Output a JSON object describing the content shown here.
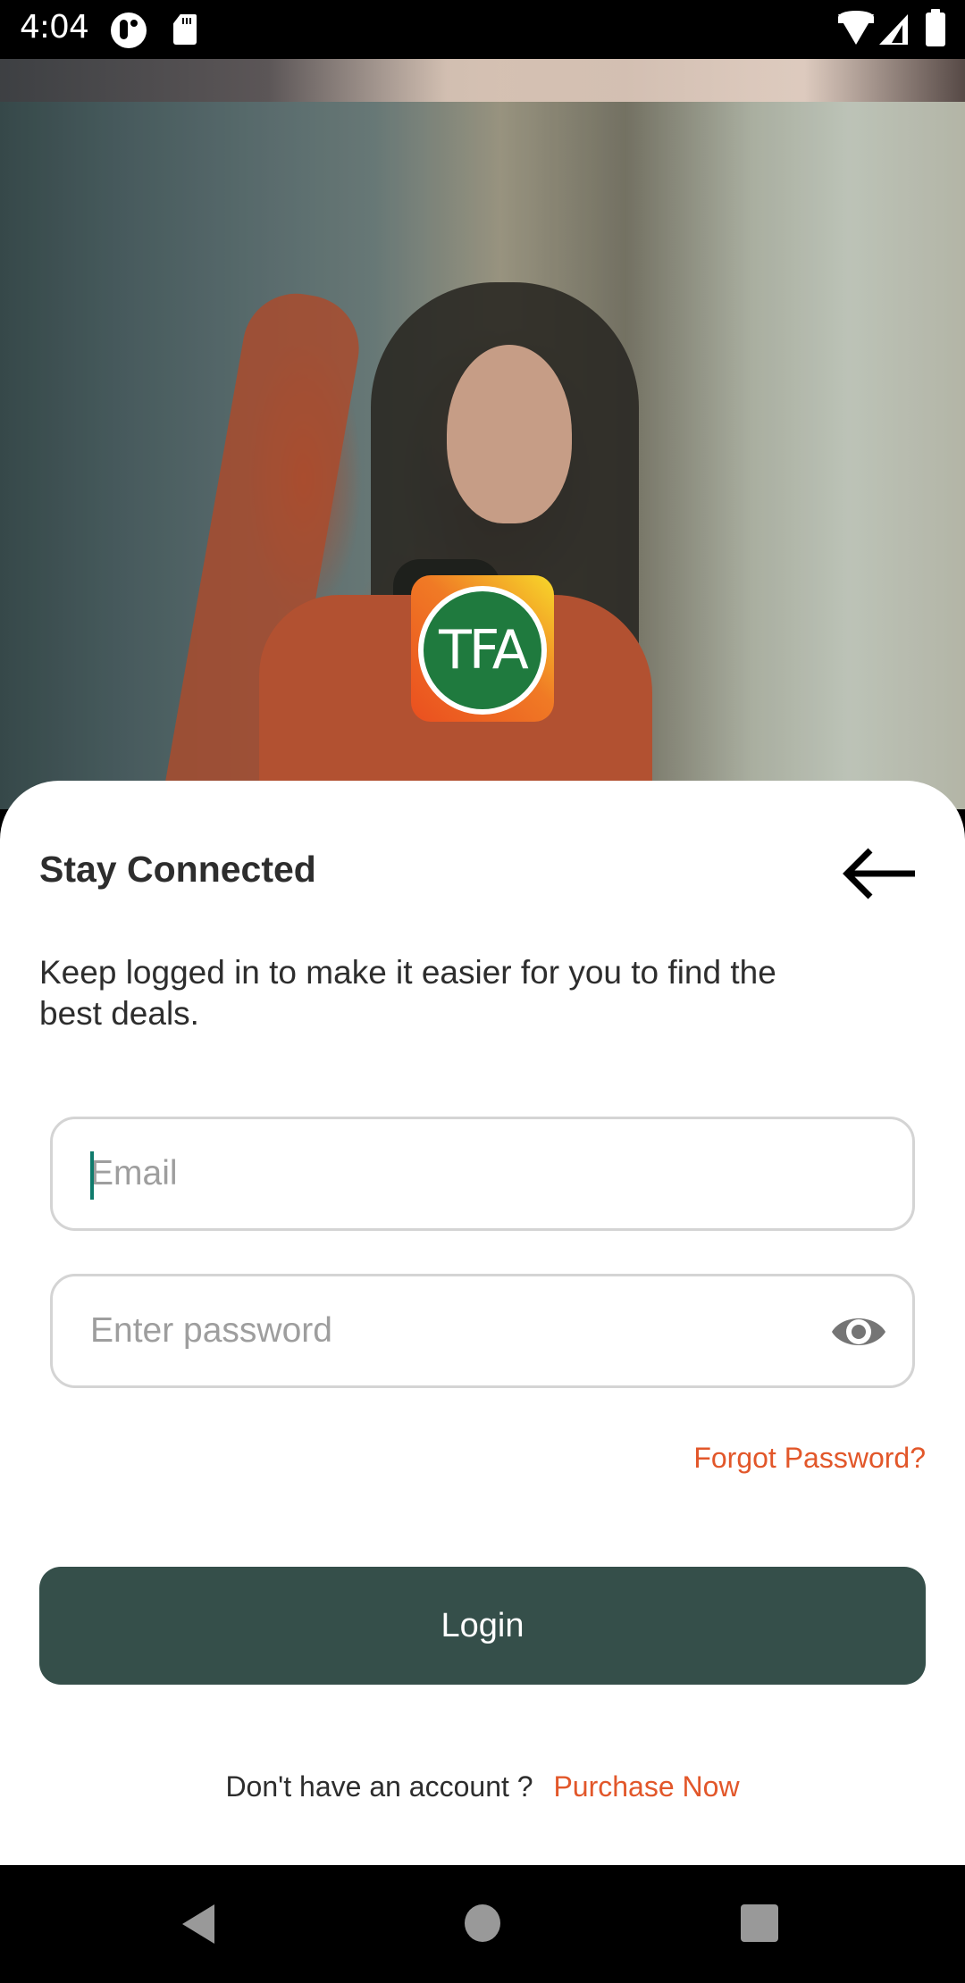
{
  "status_bar": {
    "time": "4:04",
    "left_icons": [
      "pocket-icon",
      "sd-card-icon"
    ],
    "right_icons": [
      "wifi-icon",
      "signal-icon",
      "battery-icon"
    ]
  },
  "hero": {
    "logo_text": "TFA",
    "logo_colors": {
      "circle": "#1f7a3e",
      "gradient_start": "#ea4f1f",
      "gradient_end": "#f7d82a"
    }
  },
  "sheet": {
    "title": "Stay Connected",
    "back_icon": "arrow-left-icon",
    "subtitle": "Keep logged in to make it easier for you to find the best deals."
  },
  "form": {
    "email": {
      "value": "",
      "placeholder": "Email"
    },
    "password": {
      "value": "",
      "placeholder": "Enter password",
      "toggle_icon": "eye-icon"
    },
    "forgot_password": "Forgot Password?",
    "login_label": "Login"
  },
  "signup": {
    "prompt": "Don't have an account ?",
    "link": "Purchase Now"
  },
  "colors": {
    "accent": "#e2572a",
    "primary_button": "#354f4a",
    "caret": "#0f7b6c"
  },
  "nav_bar": {
    "buttons": [
      "back",
      "home",
      "recents"
    ]
  }
}
